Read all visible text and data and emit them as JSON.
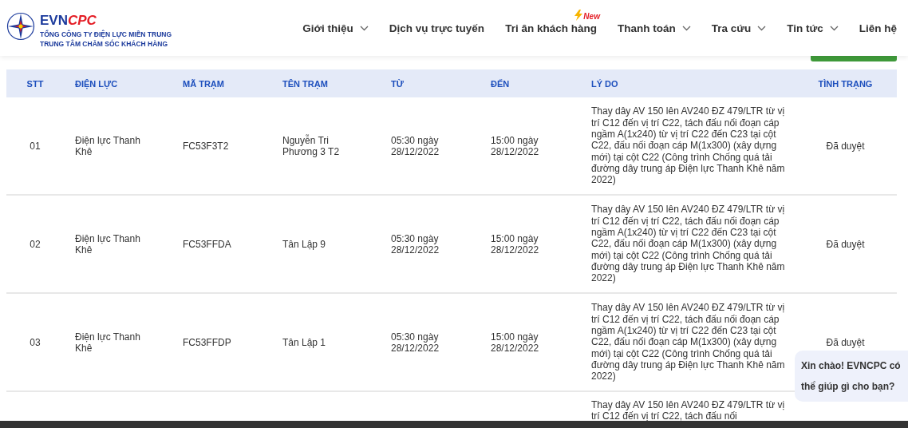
{
  "logo": {
    "brand_main": "EVN",
    "brand_accent": "CPC",
    "subtitle_1": "TỔNG CÔNG TY ĐIỆN LỰC MIỀN TRUNG",
    "subtitle_2": "TRUNG TÂM CHĂM SÓC KHÁCH HÀNG"
  },
  "nav": [
    {
      "label": "Giới thiệu",
      "dropdown": true
    },
    {
      "label": "Dịch vụ trực tuyến",
      "dropdown": false
    },
    {
      "label": "Tri ân khách hàng",
      "dropdown": false,
      "badge": "New"
    },
    {
      "label": "Thanh toán",
      "dropdown": true
    },
    {
      "label": "Tra cứu",
      "dropdown": true
    },
    {
      "label": "Tin tức",
      "dropdown": true
    },
    {
      "label": "Liên hệ",
      "dropdown": false
    }
  ],
  "table": {
    "columns": [
      "STT",
      "ĐIỆN LỰC",
      "MÃ TRẠM",
      "TÊN TRẠM",
      "TỪ",
      "ĐẾN",
      "LÝ DO",
      "TÌNH TRẠNG"
    ],
    "rows": [
      {
        "stt": "01",
        "unit": "Điện lực Thanh Khê",
        "code": "FC53F3T2",
        "station": "Nguyễn Tri Phương 3 T2",
        "from": "05:30 ngày 28/12/2022",
        "to": "15:00 ngày 28/12/2022",
        "reason": "Thay dây AV 150 lên AV240 ĐZ 479/LTR từ vị trí C12 đến vị trí C22, tách đấu nối đoạn cáp ngầm A(1x240) từ vị trí C22 đến C23 tại cột C22, đấu nối đoạn cáp M(1x300) (xây dựng mới) tại cột C22 (Công trình Chống quá tải đường dây trung áp Điện lực Thanh Khê năm 2022)",
        "status": "Đã duyệt"
      },
      {
        "stt": "02",
        "unit": "Điện lực Thanh Khê",
        "code": "FC53FFDA",
        "station": "Tân Lập 9",
        "from": "05:30 ngày 28/12/2022",
        "to": "15:00 ngày 28/12/2022",
        "reason": "Thay dây AV 150 lên AV240 ĐZ 479/LTR từ vị trí C12 đến vị trí C22, tách đấu nối đoạn cáp ngầm A(1x240) từ vị trí C22 đến C23 tại cột C22, đấu nối đoạn cáp M(1x300) (xây dựng mới) tại cột C22 (Công trình Chống quá tải đường dây trung áp Điện lực Thanh Khê năm 2022)",
        "status": "Đã duyệt"
      },
      {
        "stt": "03",
        "unit": "Điện lực Thanh Khê",
        "code": "FC53FFDP",
        "station": "Tân Lập 1",
        "from": "05:30 ngày 28/12/2022",
        "to": "15:00 ngày 28/12/2022",
        "reason": "Thay dây AV 150 lên AV240 ĐZ 479/LTR từ vị trí C12 đến vị trí C22, tách đấu nối đoạn cáp ngầm A(1x240) từ vị trí C22 đến C23 tại cột C22, đấu nối đoạn cáp M(1x300) (xây dựng mới) tại cột C22 (Công trình Chống quá tải đường dây trung áp Điện lực Thanh Khê năm 2022)",
        "status": "Đã duyệt"
      },
      {
        "reason": "Thay dây AV 150 lên AV240 ĐZ 479/LTR từ vị trí C12 đến vị trí C22, tách đấu nối"
      }
    ]
  },
  "chat_bubble": {
    "message": "Xin chào! EVNCPC có thể giúp gì cho bạn?"
  }
}
